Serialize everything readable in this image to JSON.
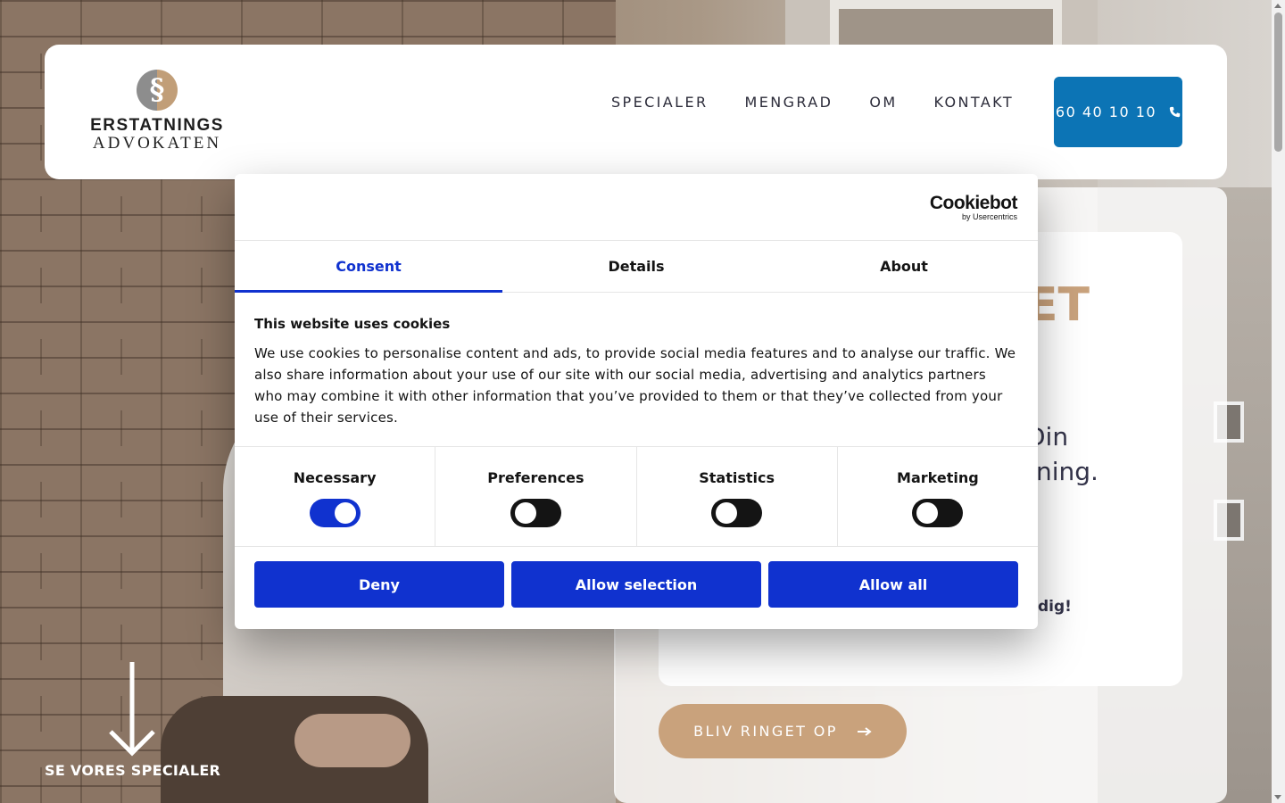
{
  "header": {
    "logo_line1": "ERSTATNINGS",
    "logo_line2": "ADVOKATEN",
    "nav": [
      "SPECIALER",
      "MENGRAD",
      "OM",
      "KONTAKT"
    ],
    "phone": "60 40 10 10"
  },
  "hero": {
    "title_fragment": "ET",
    "subtitle_line1": "Din",
    "subtitle_line2": "tning.",
    "tagline_fragment": "dig!",
    "call_button": "BLIV RINGET OP"
  },
  "specials": {
    "label": "SE VORES SPECIALER"
  },
  "cookie": {
    "brand": "Cookiebot",
    "brand_sub": "by Usercentrics",
    "tabs": [
      "Consent",
      "Details",
      "About"
    ],
    "heading": "This website uses cookies",
    "body": "We use cookies to personalise content and ads, to provide social media features and to analyse our traffic. We also share information about your use of our site with our social media, advertising and analytics partners who may combine it with other information that you’ve provided to them or that they’ve collected from your use of their services.",
    "categories": [
      {
        "label": "Necessary",
        "checked": true
      },
      {
        "label": "Preferences",
        "checked": false
      },
      {
        "label": "Statistics",
        "checked": false
      },
      {
        "label": "Marketing",
        "checked": false
      }
    ],
    "buttons": [
      "Deny",
      "Allow selection",
      "Allow all"
    ]
  },
  "colors": {
    "accent_blue": "#1032cf",
    "phone_blue": "#0c74b5",
    "gold": "#c9a27c"
  }
}
